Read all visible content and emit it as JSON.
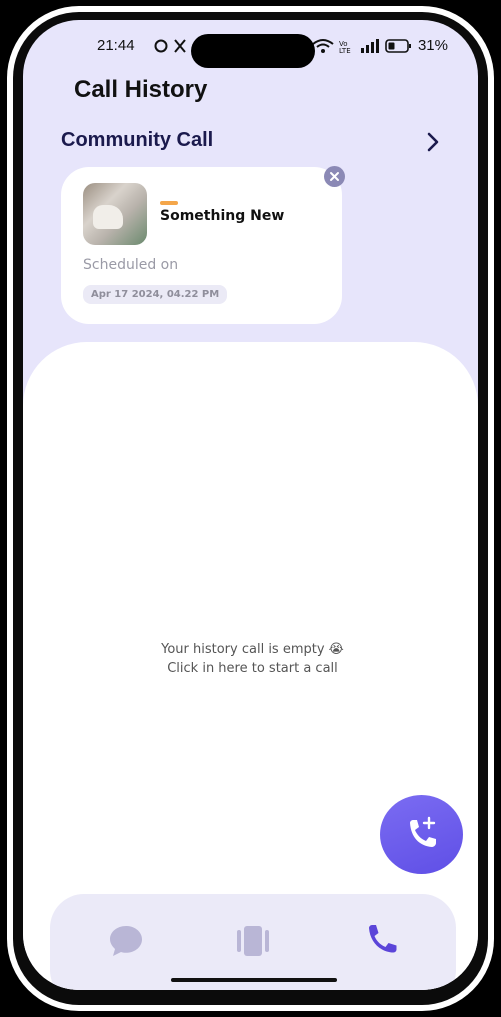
{
  "status_bar": {
    "time": "21:44",
    "battery": "31%"
  },
  "header": {
    "title": "Call History"
  },
  "community": {
    "section_title": "Community Call",
    "card": {
      "title": "Something New",
      "scheduled_label": "Scheduled on",
      "date": "Apr 17 2024, 04.22 PM"
    }
  },
  "history": {
    "empty_line1": "Your history call is empty 😭",
    "empty_line2": "Click in here to start a call"
  },
  "colors": {
    "accent": "#6a5af0",
    "nav_active": "#5b45d9",
    "nav_inactive": "#b9b6d6",
    "tag": "#f4a64a"
  },
  "icons": {
    "chevron": "chevron-right-icon",
    "close": "close-icon",
    "fab": "phone-add-icon",
    "nav": [
      "chat-bubble-icon",
      "stories-icon",
      "phone-icon"
    ]
  }
}
